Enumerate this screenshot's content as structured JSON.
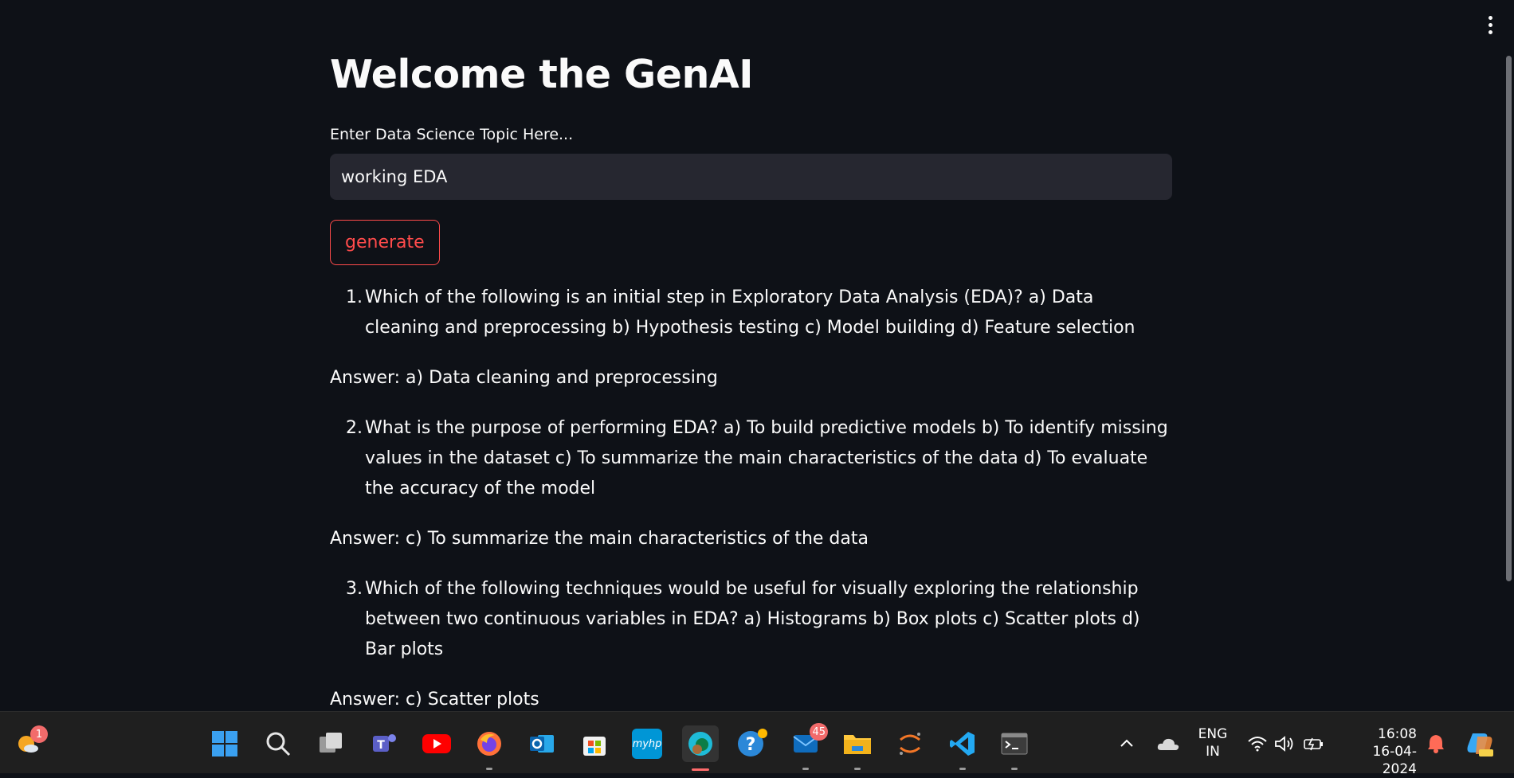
{
  "app": {
    "title": "Welcome the GenAI",
    "input_label": "Enter Data Science Topic Here...",
    "input_value": "working EDA",
    "generate_label": "generate"
  },
  "qa": [
    {
      "num": "1.",
      "question": "Which of the following is an initial step in Exploratory Data Analysis (EDA)? a) Data cleaning and preprocessing b) Hypothesis testing c) Model building d) Feature selection",
      "answer": "Answer: a) Data cleaning and preprocessing"
    },
    {
      "num": "2.",
      "question": "What is the purpose of performing EDA? a) To build predictive models b) To identify missing values in the dataset c) To summarize the main characteristics of the data d) To evaluate the accuracy of the model",
      "answer": "Answer: c) To summarize the main characteristics of the data"
    },
    {
      "num": "3.",
      "question": "Which of the following techniques would be useful for visually exploring the relationship between two continuous variables in EDA? a) Histograms b) Box plots c) Scatter plots d) Bar plots",
      "answer": "Answer: c) Scatter plots"
    }
  ],
  "taskbar": {
    "weather_badge": "1",
    "mail_badge": "45",
    "myhp_label": "myhp",
    "language_line1": "ENG",
    "language_line2": "IN",
    "time": "16:08",
    "date": "16-04-2024",
    "icons": [
      "weather-icon",
      "windows-start-icon",
      "search-icon",
      "task-view-icon",
      "teams-icon",
      "youtube-icon",
      "firefox-icon",
      "outlook-icon",
      "store-icon",
      "myhp-icon",
      "edge-icon",
      "help-icon",
      "mail-icon",
      "file-explorer-icon",
      "jupyter-icon",
      "vscode-icon",
      "terminal-icon"
    ]
  },
  "colors": {
    "background": "#0e1117",
    "input_bg": "#262730",
    "accent": "#ff4b4b",
    "taskbar": "#1f1f1f"
  }
}
